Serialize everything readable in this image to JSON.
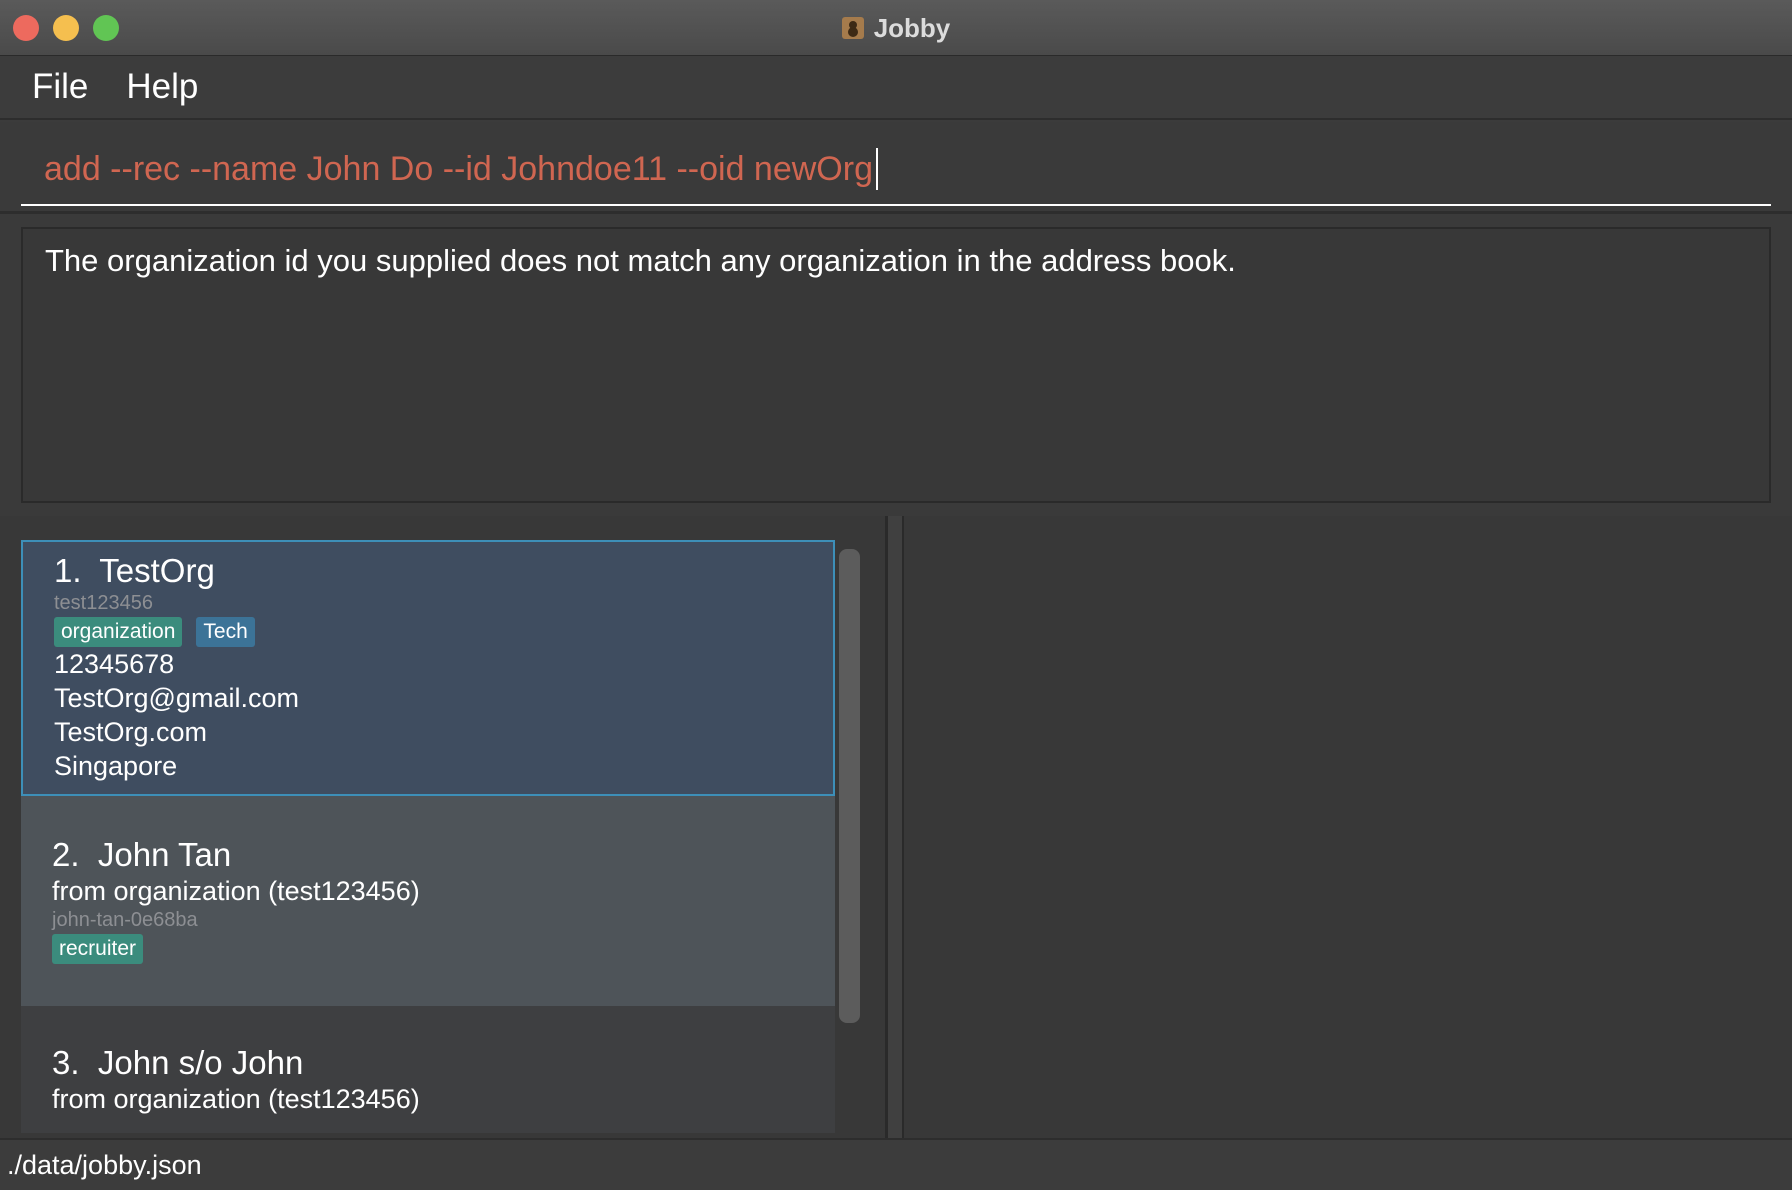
{
  "window": {
    "title": "Jobby"
  },
  "menu": {
    "file_label": "File",
    "help_label": "Help"
  },
  "command": {
    "value": "add --rec --name John Do --id Johndoe11 --oid newOrg"
  },
  "result": {
    "message": "The organization id you supplied does not match any organization in the address book."
  },
  "contacts": [
    {
      "index": "1.",
      "name": "TestOrg",
      "id": "test123456",
      "tags": [
        "organization",
        "Tech"
      ],
      "phone": "12345678",
      "email": "TestOrg@gmail.com",
      "url": "TestOrg.com",
      "address": "Singapore"
    },
    {
      "index": "2.",
      "name": "John Tan",
      "from": "from organization (test123456)",
      "id": "john-tan-0e68ba",
      "tags": [
        "recruiter"
      ]
    },
    {
      "index": "3.",
      "name": "John s/o John",
      "from": "from organization (test123456)"
    }
  ],
  "status": {
    "path": "./data/jobby.json"
  },
  "colors": {
    "command_error": "#d06651",
    "tag_role": "#3b8c7d",
    "tag_other": "#3c7397",
    "selection_border": "#3d8fb8"
  }
}
